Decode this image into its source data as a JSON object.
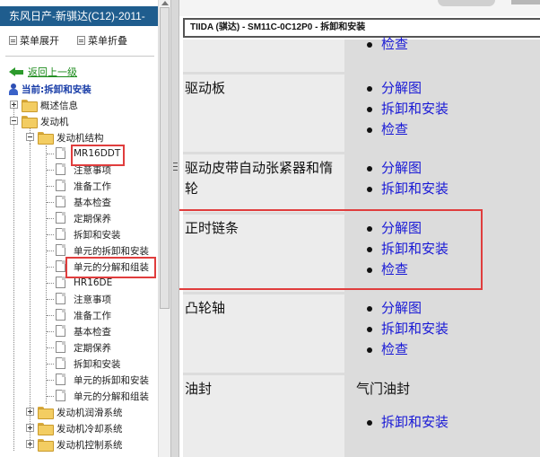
{
  "sidebar": {
    "title": "东风日产-新骐达(C12)-2011-",
    "expand_all": "菜单展开",
    "collapse_all": "菜单折叠",
    "back_link": "返回上一级",
    "current": "当前:拆卸和安装",
    "tree": {
      "overview": "概述信息",
      "engine": "发动机",
      "engine_structure": "发动机结构",
      "mr16ddt": {
        "name": "MR16DDT",
        "items": [
          "注意事项",
          "准备工作",
          "基本检查",
          "定期保养",
          "拆卸和安装",
          "单元的拆卸和安装",
          "单元的分解和组装"
        ]
      },
      "hr16de": {
        "name": "HR16DE",
        "items": [
          "注意事项",
          "准备工作",
          "基本检查",
          "定期保养",
          "拆卸和安装",
          "单元的拆卸和安装",
          "单元的分解和组装"
        ]
      },
      "lubrication": "发动机润滑系统",
      "cooling": "发动机冷却系统",
      "control": "发动机控制系统"
    }
  },
  "document": {
    "title": "TIIDA (骐达) - SM11C-0C12P0 - 拆卸和安装",
    "rows": [
      {
        "name": "",
        "links": [
          "检查"
        ]
      },
      {
        "name": "驱动板",
        "links": [
          "分解图",
          "拆卸和安装",
          "检查"
        ]
      },
      {
        "name": "驱动皮带自动张紧器和惰轮",
        "links": [
          "分解图",
          "拆卸和安装"
        ]
      },
      {
        "name": "正时链条",
        "links": [
          "分解图",
          "拆卸和安装",
          "检查"
        ]
      },
      {
        "name": "凸轮轴",
        "links": [
          "分解图",
          "拆卸和安装",
          "检查"
        ]
      },
      {
        "name": "油封",
        "subheading": "气门油封",
        "links": [
          "拆卸和安装"
        ]
      }
    ]
  },
  "colors": {
    "title_bar": "#1f5d8e",
    "link": "#1a1ad6",
    "annotation": "#e03d3d",
    "back_link": "#1a8a1a"
  }
}
